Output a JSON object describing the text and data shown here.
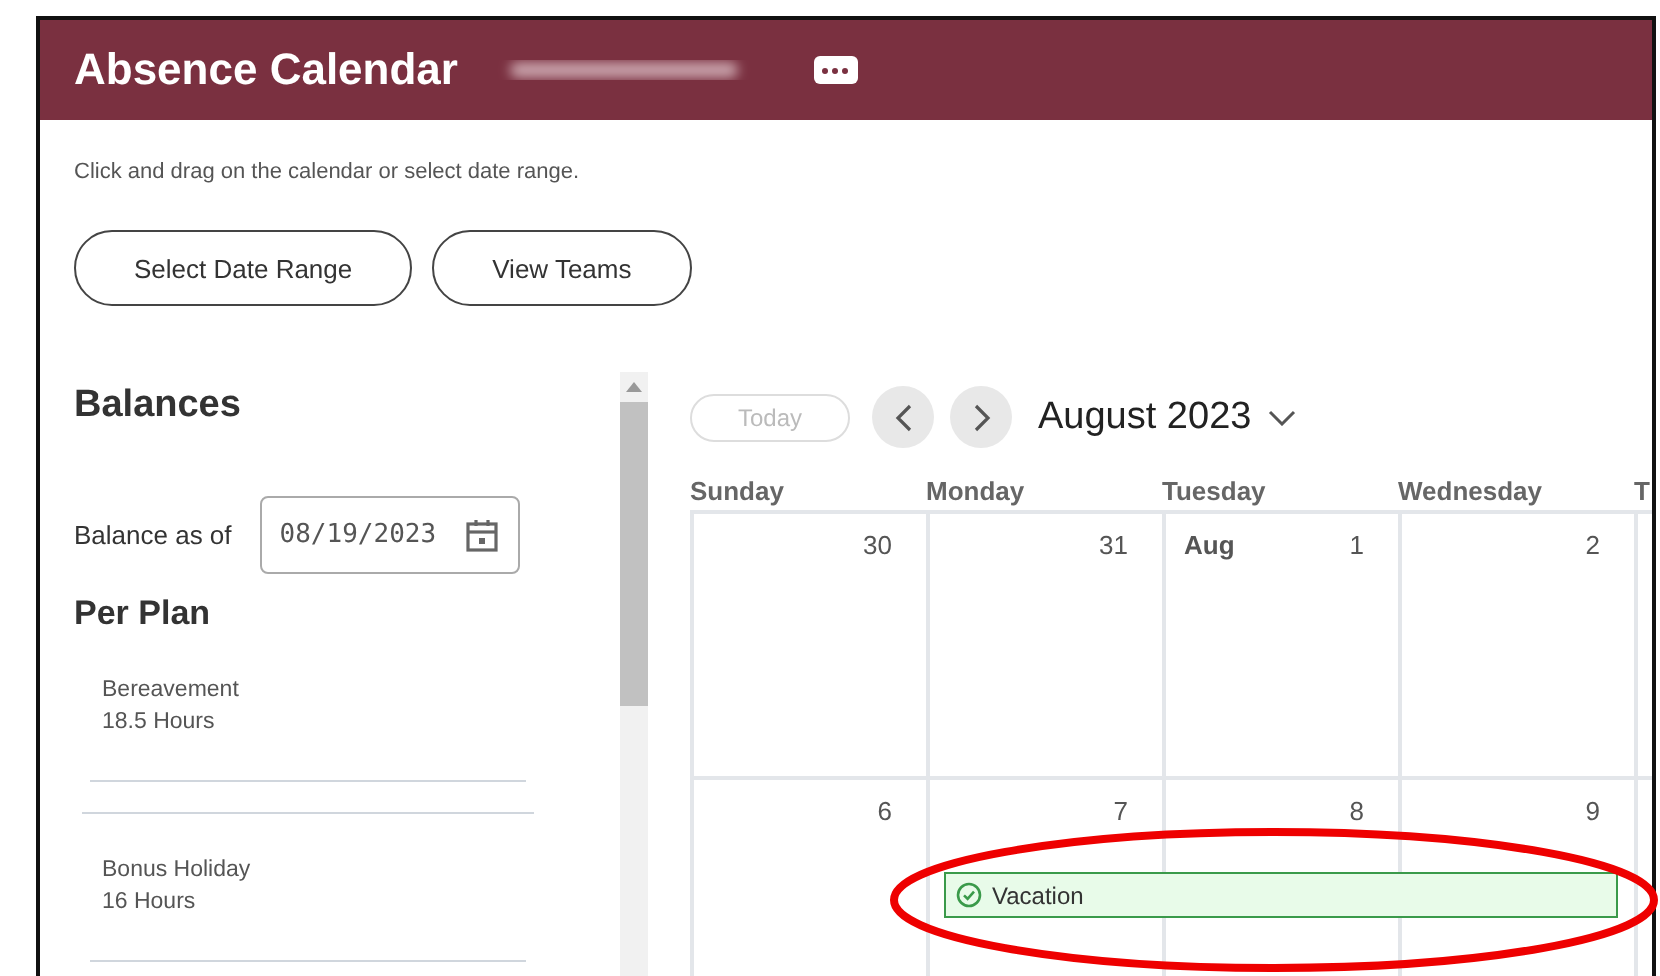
{
  "header": {
    "title": "Absence Calendar"
  },
  "instruction": "Click and drag on the calendar or select date range.",
  "actions": [
    {
      "label": "Select Date Range"
    },
    {
      "label": "View Teams"
    }
  ],
  "balances": {
    "title": "Balances",
    "as_of_label": "Balance as of",
    "as_of_value": "08/19/2023",
    "plan_title": "Per Plan",
    "plans": [
      {
        "name": "Bereavement",
        "amount": "18.5 Hours"
      },
      {
        "name": "Bonus Holiday",
        "amount": "16 Hours"
      }
    ]
  },
  "calendar": {
    "today_button": {
      "label": "Today",
      "disabled": true
    },
    "month": "August 2023",
    "weekdays": [
      "Sunday",
      "Monday",
      "Tuesday",
      "Wednesday",
      "T"
    ],
    "weeks": [
      {
        "days": [
          {
            "day": "30"
          },
          {
            "day": "31"
          },
          {
            "month": "Aug",
            "day": "1"
          },
          {
            "day": "2"
          }
        ]
      },
      {
        "days": [
          {
            "day": "6"
          },
          {
            "day": "7"
          },
          {
            "day": "8"
          },
          {
            "day": "9"
          }
        ],
        "events": [
          {
            "label": "Vacation",
            "approved": true
          }
        ]
      }
    ]
  }
}
